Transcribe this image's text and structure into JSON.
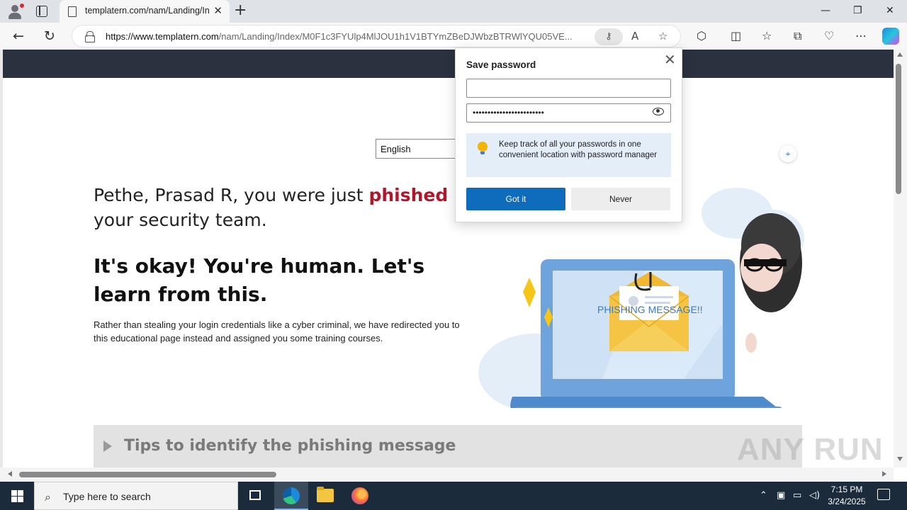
{
  "browser": {
    "tab_title": "templatern.com/nam/Landing/In",
    "url_domain": "https://www.templatern.com",
    "url_path": "/nam/Landing/Index/M0F1c3FYUlp4MlJOU1h1V1BTYmZBeDJWbzBTRWlYQU05VE...",
    "new_tab_glyph": "+",
    "close_glyph": "✕",
    "minimize_glyph": "—",
    "restore_glyph": "❐",
    "window_close_glyph": "✕",
    "back_glyph": "←",
    "refresh_glyph": "↻",
    "icons": [
      "profile-icon",
      "tab-actions-icon",
      "lock-icon",
      "key-icon",
      "read-aloud-icon",
      "favorite-star-icon",
      "extensions-icon",
      "split-screen-icon",
      "favorites-icon",
      "collections-icon",
      "browser-essentials-icon",
      "more-icon",
      "copilot-icon"
    ]
  },
  "page": {
    "language": "English",
    "headline_part1": "Pethe, Prasad R, you were just ",
    "headline_phished": "phished",
    "headline_part2": " by your security team.",
    "subhead": "It's okay! You're human. Let's learn from this.",
    "body": "Rather than stealing your login credentials like a cyber criminal, we have redirected you to this educational page instead and assigned you some training courses.",
    "illustration_caption": "PHISHING MESSAGE!!",
    "tips_label": "Tips to identify the phishing message",
    "watermark": "ANY RUN",
    "accent_color": "#b3162b",
    "header_color": "#2c3140"
  },
  "save_password": {
    "title": "Save password",
    "username_value": "",
    "password_value": "••••••••••••••••••••••••",
    "info_text": "Keep track of all your passwords in one convenient location with password manager",
    "got_it_label": "Got it",
    "never_label": "Never",
    "primary_color": "#0f6cbd"
  },
  "taskbar": {
    "search_placeholder": "Type here to search",
    "time": "7:15 PM",
    "date": "3/24/2025"
  }
}
